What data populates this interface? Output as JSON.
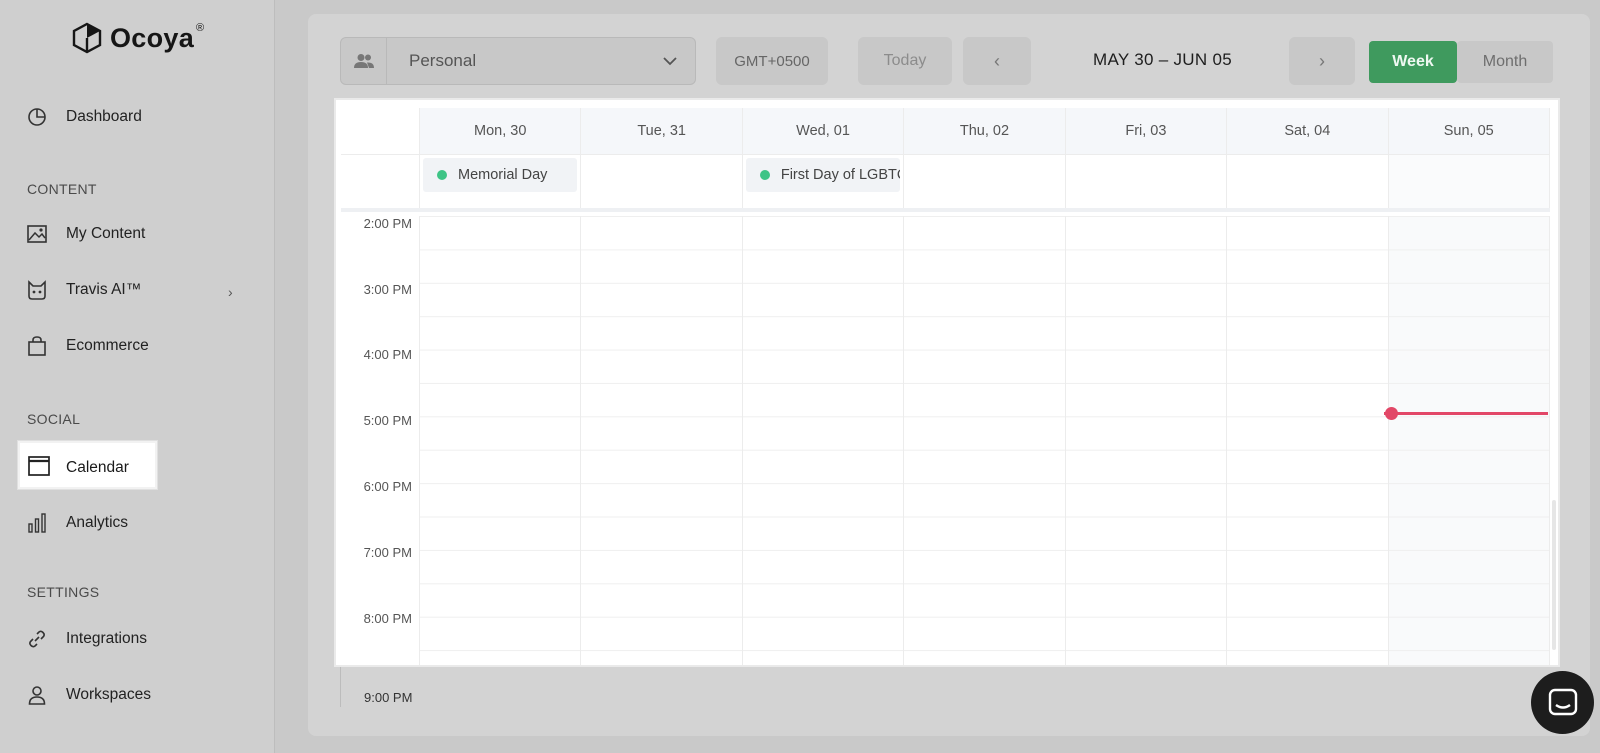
{
  "brand": {
    "name": "Ocoya",
    "reg": "®"
  },
  "sidebar": {
    "items": [
      {
        "label": "Dashboard",
        "icon": "pie-chart-icon"
      },
      {
        "label": "My Content",
        "icon": "image-icon"
      },
      {
        "label": "Travis AI™",
        "icon": "robot-icon"
      },
      {
        "label": "Ecommerce",
        "icon": "shopping-bag-icon"
      },
      {
        "label": "Calendar",
        "icon": "calendar-icon"
      },
      {
        "label": "Analytics",
        "icon": "bar-chart-icon"
      },
      {
        "label": "Integrations",
        "icon": "link-icon"
      },
      {
        "label": "Workspaces",
        "icon": "user-icon"
      }
    ],
    "sections": {
      "content": "CONTENT",
      "social": "SOCIAL",
      "settings": "SETTINGS"
    }
  },
  "toolbar": {
    "account": "Personal",
    "timezone": "GMT+0500",
    "today": "Today",
    "range": "MAY 30 – JUN 05",
    "week": "Week",
    "month": "Month"
  },
  "calendar": {
    "days": [
      "Mon, 30",
      "Tue, 31",
      "Wed, 01",
      "Thu, 02",
      "Fri, 03",
      "Sat, 04",
      "Sun, 05"
    ],
    "events": {
      "mon": "Memorial Day",
      "wed": "First Day of LGBTQ+"
    },
    "times": [
      "2:00 PM",
      "3:00 PM",
      "4:00 PM",
      "5:00 PM",
      "6:00 PM",
      "7:00 PM",
      "8:00 PM"
    ],
    "below_time": "9:00 PM"
  },
  "colors": {
    "accent": "#3f9a5e",
    "now": "#e24767",
    "event_dot": "#3ec486"
  }
}
